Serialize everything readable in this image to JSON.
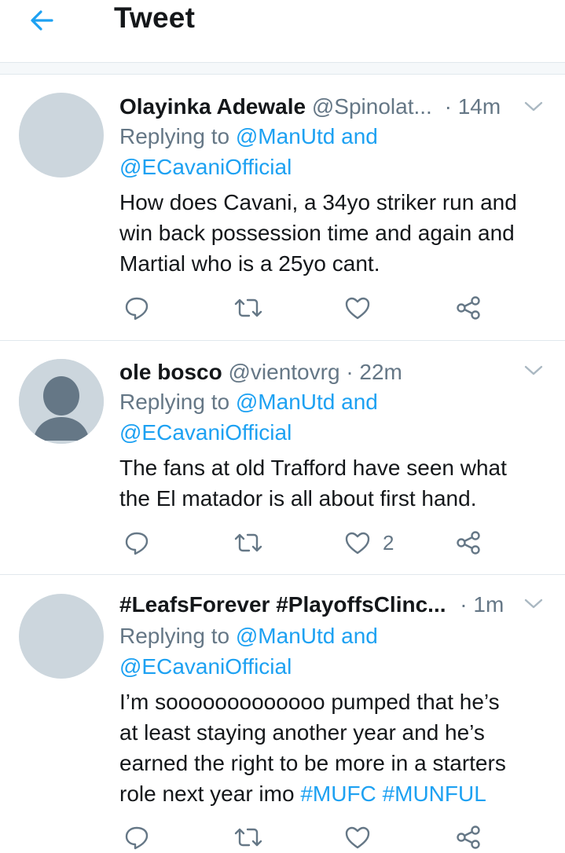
{
  "header": {
    "title": "Tweet"
  },
  "tweets": [
    {
      "name": "Olayinka Adewale",
      "handle": "@Spinolat...",
      "time": "· 14m",
      "reply_prefix": "Replying to",
      "reply_to_1": "@ManUtd",
      "reply_and": "and",
      "reply_to_2": "@ECavaniOfficial",
      "text_lines": [
        "How does Cavani, a 34yo striker run and",
        "win back possession time and again and",
        "Martial who is a 25yo cant."
      ],
      "like_count": ""
    },
    {
      "name": "ole bosco",
      "handle": "@vientovrg",
      "time": "· 22m",
      "reply_prefix": "Replying to",
      "reply_to_1": "@ManUtd",
      "reply_and": "and",
      "reply_to_2": "@ECavaniOfficial",
      "text_lines": [
        "The fans at old Trafford have seen what",
        "the El matador is all about first hand."
      ],
      "like_count": "2"
    },
    {
      "name": "#LeafsForever #PlayoffsClinc...",
      "handle": "",
      "time": "· 1m",
      "reply_prefix": "Replying to",
      "reply_to_1": "@ManUtd",
      "reply_and": "and",
      "reply_to_2": "@ECavaniOfficial",
      "text_lines": [
        "I’m sooooooooooooo pumped that he’s",
        "at least staying another year and he’s",
        "earned the right to be more in a starters"
      ],
      "text_last_plain": "role next year imo",
      "hashtag_1": "#MUFC",
      "hashtag_2": "#MUNFUL",
      "like_count": ""
    }
  ],
  "icons": {
    "back": "arrow-left-icon",
    "caret": "chevron-down-icon",
    "reply": "reply-icon",
    "retweet": "retweet-icon",
    "like": "heart-icon",
    "share": "share-icon"
  },
  "colors": {
    "accent": "#1da1f2",
    "muted": "#657786",
    "text": "#14171a",
    "avatar": "#ccd6dd"
  }
}
